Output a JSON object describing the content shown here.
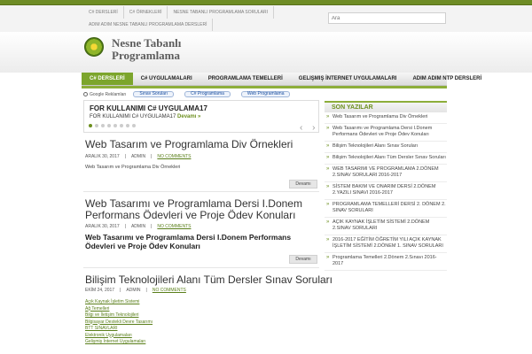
{
  "topbar": {
    "links": [
      "C# DERSLERİ",
      "C# ÖRNEKLERİ",
      "NESNE TABANLI PROGRAMLAMA SORULARI",
      "ADIM ADIM NESNE TABANLI PROGRAMLAMA DERSLERİ"
    ],
    "search_placeholder": "Ara"
  },
  "logo": {
    "line1": "Nesne Tabanlı",
    "line2": "Programlama"
  },
  "nav": {
    "items": [
      "C# DERSLERİ",
      "C# UYGULAMALARI",
      "PROGRAMLAMA TEMELLERİ",
      "Gelişmiş İnternet Uygulamaları",
      "ADIM ADIM NTP DERSLERİ"
    ]
  },
  "ads": {
    "label": "Google Reklamları",
    "buttons": [
      "Sınav Soruları",
      "C# Programlama",
      "Web Programlama"
    ]
  },
  "slider": {
    "title": "FOR KULLANIMI C# UYGULAMA17",
    "text": "FOR KULLANIMI C# UYGULAMA17",
    "more": "Devamı »",
    "arrows": "‹ ›"
  },
  "posts": [
    {
      "title": "Web Tasarım ve Programlama Div Örnekleri",
      "date": "ARALIK 30, 2017",
      "author": "ADMIN",
      "comments": "NO COMMENTS",
      "excerpt": "Web Tasarım ve Programlama Div Örnekleri",
      "more": "Devamı"
    },
    {
      "title_line1": "Web Tasarımı ve Programlama Dersi I.Donem",
      "title_line2": "Performans Ödevleri ve Proje Ödev Konuları",
      "date": "ARALIK 30, 2017",
      "author": "ADMIN",
      "comments": "NO COMMENTS",
      "excerpt": "Web Tasarımı ve Programlama Dersi I.Donem Performans Ödevleri ve Proje Ödev Konuları",
      "more": "Devamı"
    },
    {
      "title": "Bilişim Teknolojileri Alanı Tüm Dersler Sınav Soruları",
      "date": "EKİM 24, 2017",
      "author": "ADMIN",
      "comments": "NO COMMENTS",
      "links": [
        "Açık Kaynak İşletim Sistemi",
        "Ağ Temelleri",
        "Bilgi ve İletişim Teknolojileri",
        "Bilgisayar Destekli Devre Tasarımı",
        "BTT SINAVLARI",
        "Elektronik Uygulamaları",
        "Gelişmiş İnternet Uygulamaları"
      ]
    }
  ],
  "sidebar": {
    "heading": "SON YAZILAR",
    "items": [
      "Web Tasarım ve Programlama Div Örnekleri",
      "Web Tasarımı ve Programlama Dersi I.Donem Performans Ödevleri ve Proje Ödev Konuları",
      "Bilişim Teknolojileri Alanı Sınav Soruları",
      "Bilişim Teknolojileri Alanı Tüm Dersler Sınav Soruları",
      "WEB TASARIMI VE PROGRAMLAMA 2.DÖNEM 2.SINAV SORULARI 2016-2017",
      "SİSTEM BAKIM VE ONARIM DERSİ 2.DÖNEM 2.YAZILI SINAVI 2016-2017",
      "PROGRAMLAMA TEMELLERİ DERSİ 2. DÖNEM 2. SINAV SORULARI",
      "AÇIK KAYNAK İŞLETİM SİSTEMİ 2.DÖNEM 2.SINAV SORULARI",
      "2016-2017 EĞİTİM ÖĞRETİM YILI AÇIK KAYNAK İŞLETİM SİSTEMİ 2.DÖNEM 1. SINAV SORULARI",
      "Programlama Temelleri 2.Dönem 2.Sınavı 2016-2017"
    ]
  },
  "colors": {
    "accent": "#6c8f1e",
    "nav_active": "#7ca52c",
    "top_stripe": "#6e8c25"
  }
}
